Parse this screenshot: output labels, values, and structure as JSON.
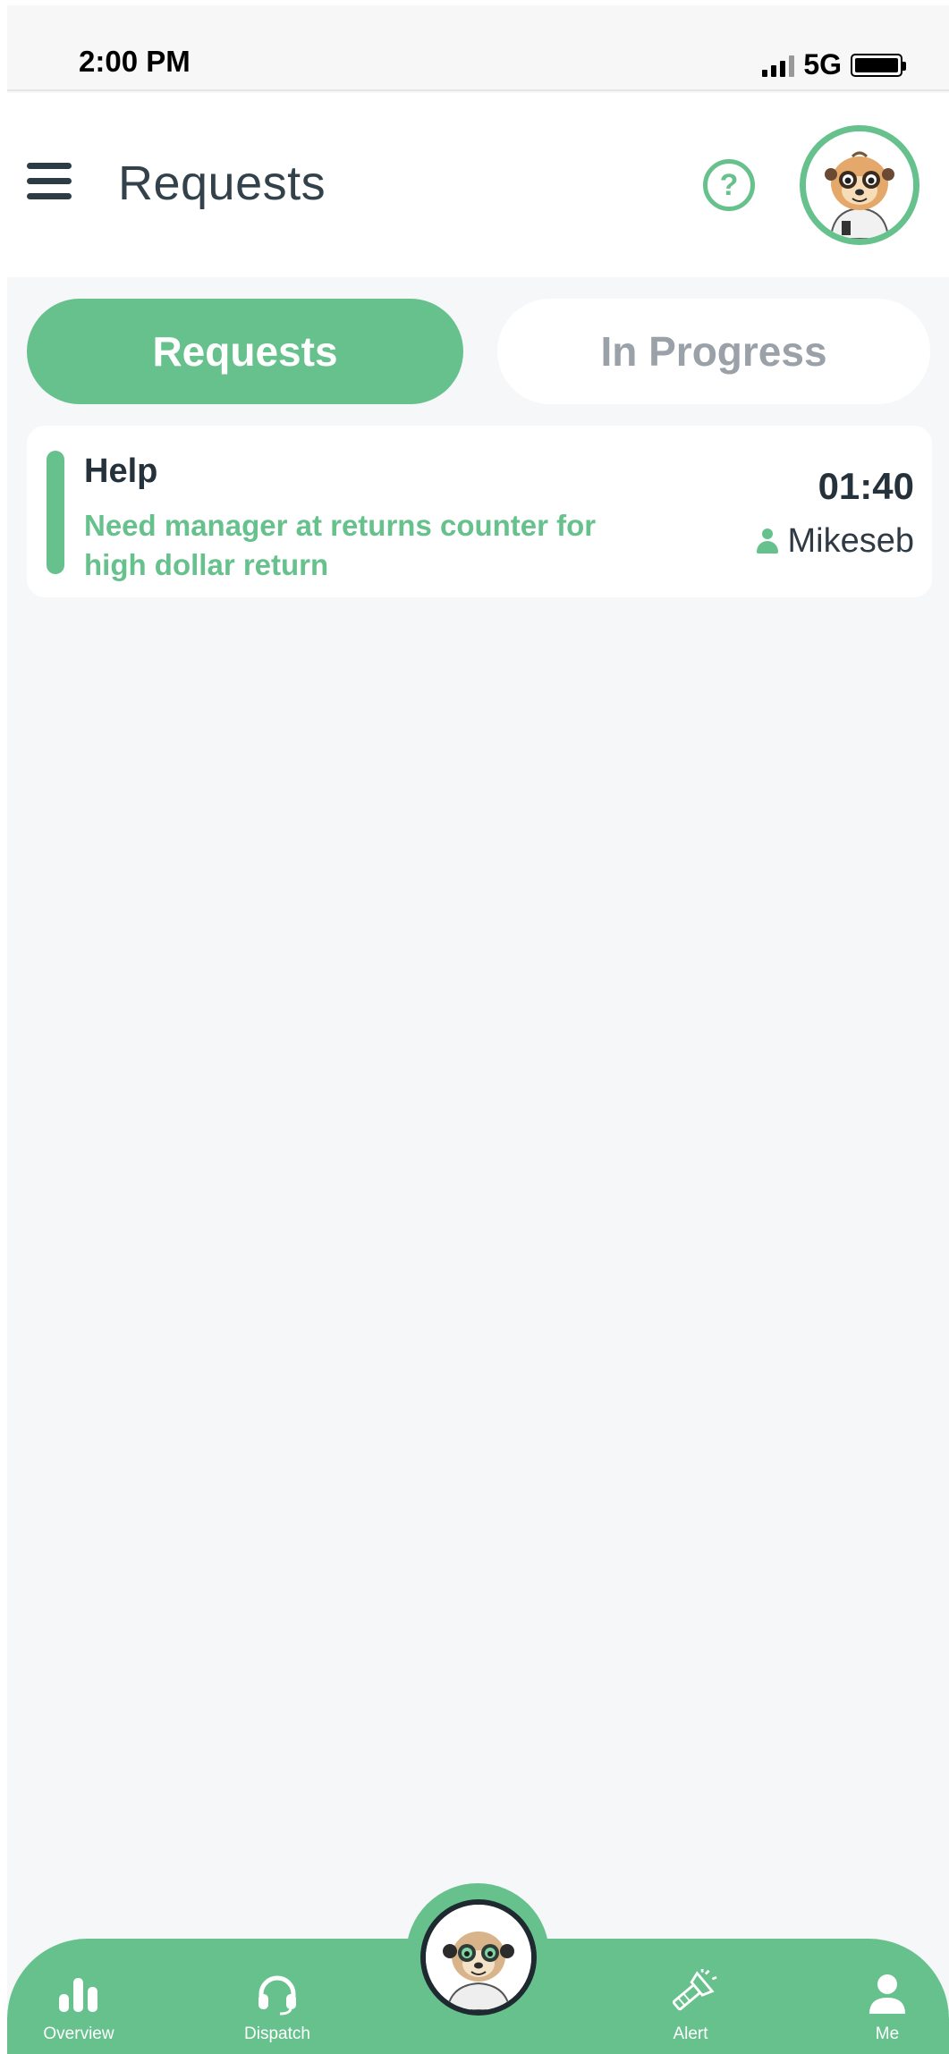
{
  "status_bar": {
    "time": "2:00 PM",
    "network": "5G"
  },
  "header": {
    "title": "Requests",
    "help_symbol": "?"
  },
  "tabs": [
    {
      "label": "Requests",
      "active": true
    },
    {
      "label": "In Progress",
      "active": false
    }
  ],
  "requests": [
    {
      "title": "Help",
      "description": "Need manager at returns counter for high dollar return",
      "elapsed": "01:40",
      "user": "Mikeseb"
    }
  ],
  "bottom_nav": [
    {
      "label": "Overview",
      "icon": "bar-chart-icon"
    },
    {
      "label": "Dispatch",
      "icon": "headset-icon"
    },
    {
      "label": "",
      "icon": "meerkat-avatar"
    },
    {
      "label": "Alert",
      "icon": "flashlight-icon"
    },
    {
      "label": "Me",
      "icon": "person-icon"
    }
  ],
  "colors": {
    "accent": "#67c18d",
    "background": "#f6f7f9",
    "text_dark": "#2f3a45",
    "tab_inactive_text": "#9aa1a8"
  }
}
